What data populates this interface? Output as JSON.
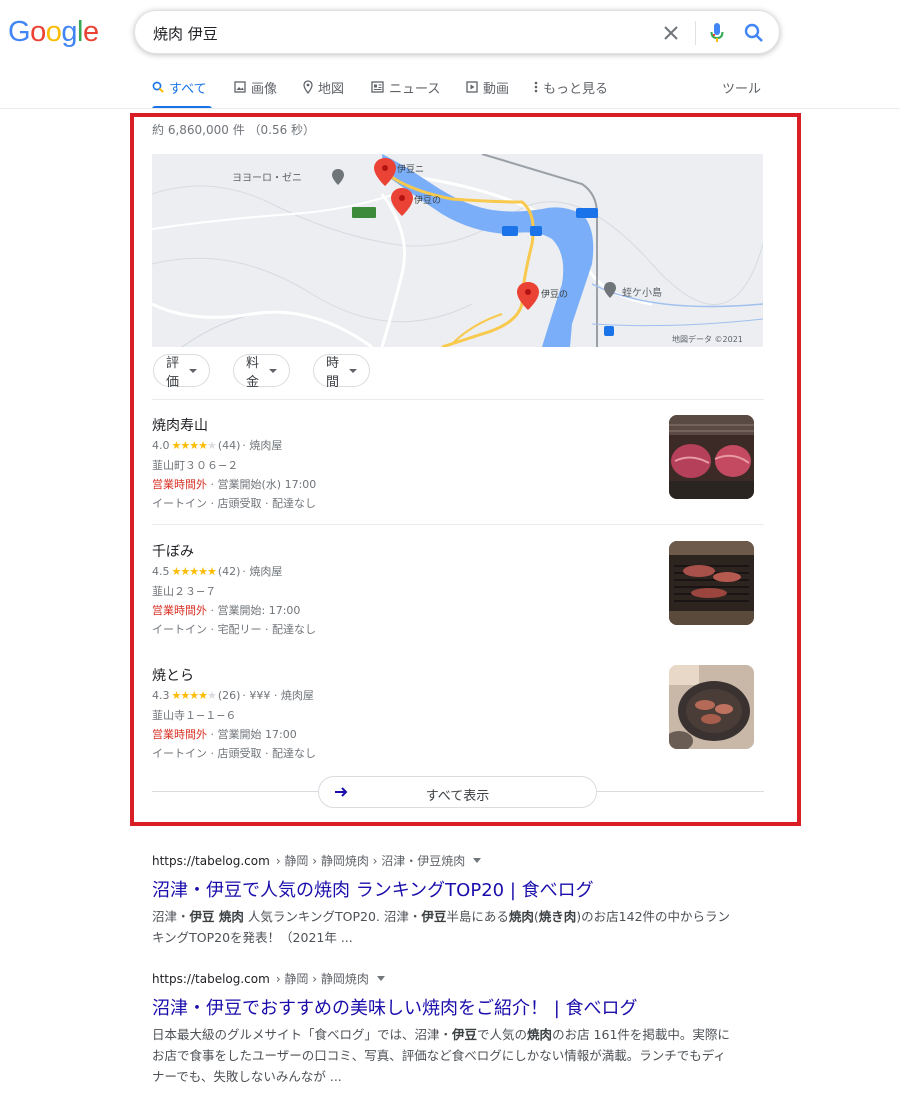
{
  "logo": {
    "text": "Google"
  },
  "search": {
    "query": "焼肉 伊豆"
  },
  "tabs": [
    {
      "label": "すべて",
      "icon": "search-icon",
      "active": true
    },
    {
      "label": "画像",
      "icon": "image-icon"
    },
    {
      "label": "地図",
      "icon": "map-pin-icon"
    },
    {
      "label": "ニュース",
      "icon": "news-icon"
    },
    {
      "label": "動画",
      "icon": "video-icon"
    },
    {
      "label": "もっと見る",
      "icon": "more-vert-icon"
    }
  ],
  "tools_label": "ツール",
  "result_stats": "約 6,860,000 件 （0.56 秒）",
  "map": {
    "labels": [
      "ヨヨーロ・ゼニ",
      "伊豆ニ",
      "伊豆の",
      "伊豆の",
      "蛭ケ小島"
    ],
    "footer": "地図データ ©2021"
  },
  "filters": [
    {
      "label": "評価"
    },
    {
      "label": "料金"
    },
    {
      "label": "時間"
    }
  ],
  "places": [
    {
      "name": "焼肉寿山",
      "rating": "4.0",
      "stars_full": 4,
      "reviews": "(44)",
      "category": "· 焼肉屋",
      "address": "韮山町３０６−２",
      "hours_closed": "営業時間外",
      "hours_rest": " · 営業開始(水) 17:00",
      "services": "イートイン · 店頭受取 · 配達なし"
    },
    {
      "name": "千ぼみ",
      "rating": "4.5",
      "stars_full": 5,
      "reviews": "(42)",
      "category": "· 焼肉屋",
      "address": "韮山２３−７",
      "hours_closed": "営業時間外",
      "hours_rest": " · 営業開始: 17:00",
      "services": "イートイン · 宅配リー · 配達なし"
    },
    {
      "name": "焼とら",
      "rating": "4.3",
      "stars_full": 4,
      "reviews": "(26)",
      "category": "· ¥¥¥ · 焼肉屋",
      "address": "韮山寺１−１−６",
      "hours_closed": "営業時間外",
      "hours_rest": " · 営業開始 17:00",
      "services": "イートイン · 店頭受取 · 配達なし"
    }
  ],
  "view_all": {
    "label": "すべて表示"
  },
  "organic": [
    {
      "domain": "https://tabelog.com",
      "path": " › 静岡 › 静岡焼肉 › 沼津・伊豆焼肉",
      "title": "沼津・伊豆で人気の焼肉 ランキングTOP20 | 食べログ",
      "snippet_html": "沼津・<b>伊豆 焼肉</b> 人気ランキングTOP20. 沼津・<b>伊豆</b>半島にある<b>焼肉</b>(<b>焼き肉</b>)のお店142件の中からランキングTOP20を発表！（2021年 ..."
    },
    {
      "domain": "https://tabelog.com",
      "path": " › 静岡 › 静岡焼肉",
      "title": "沼津・伊豆でおすすめの美味しい焼肉をご紹介！ | 食べログ",
      "snippet_html": "日本最大級のグルメサイト「食べログ」では、沼津・<b>伊豆</b>で人気の<b>焼肉</b>のお店 161件を掲載中。実際にお店で食事をしたユーザーの口コミ、写真、評価など食べログにしかない情報が満載。ランチでもディナーでも、失敗しないみんなが ..."
    }
  ],
  "colors": {
    "highlight": "#d91e26",
    "link": "#1a0dab",
    "accent": "#1a73e8",
    "star": "#fbbc04"
  }
}
